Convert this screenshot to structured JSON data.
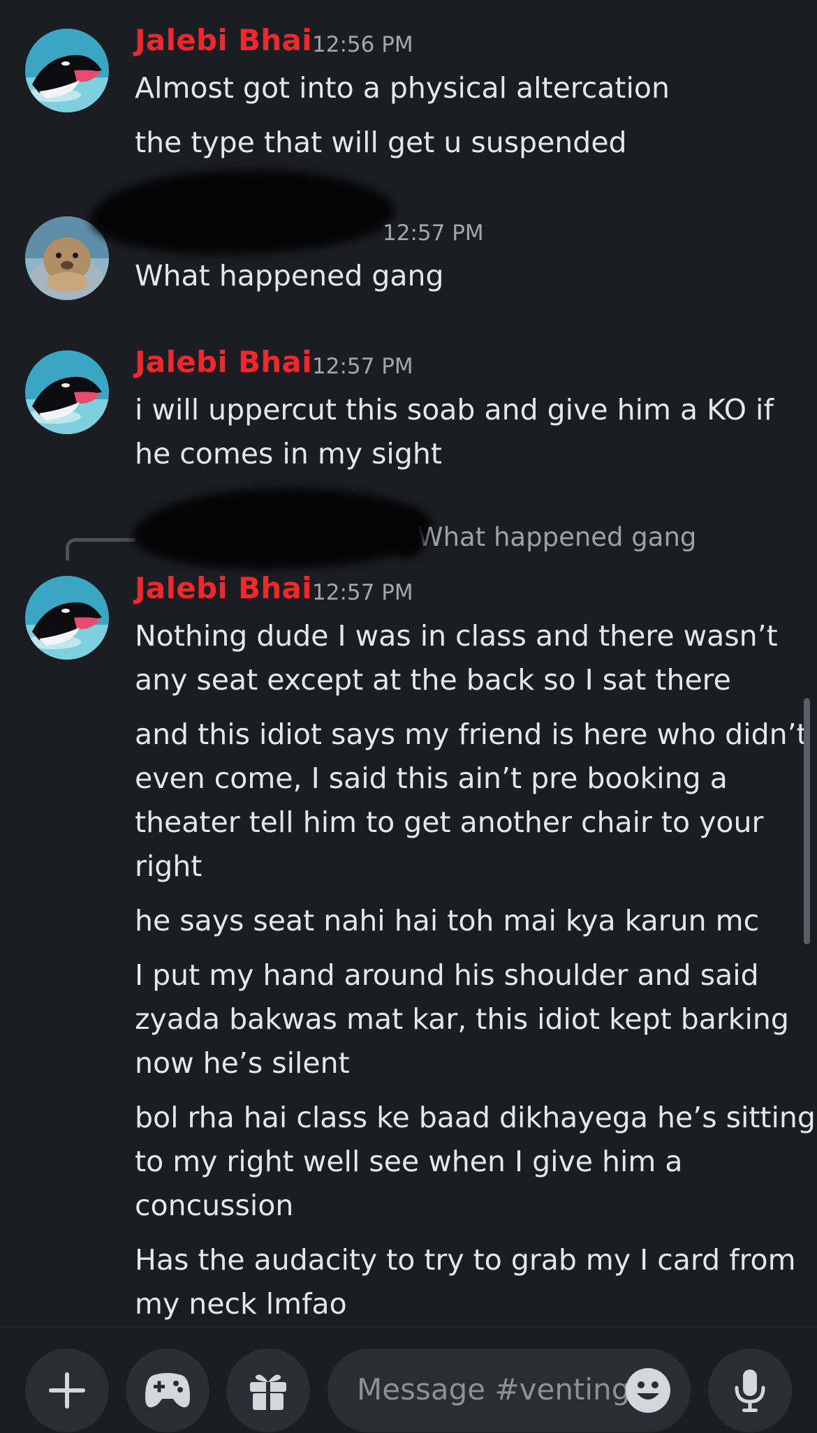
{
  "messages": [
    {
      "author": "Jalebi Bhai",
      "time": "12:56 PM",
      "lines": [
        "Almost got into a physical altercation",
        "the type that will get u suspended"
      ]
    },
    {
      "author": "",
      "time": "12:57 PM",
      "lines": [
        "What happened gang"
      ]
    },
    {
      "author": "Jalebi Bhai",
      "time": "12:57 PM",
      "lines": [
        "i will uppercut this soab and give him a KO if",
        "he comes in my sight"
      ]
    },
    {
      "reply_preview": "What happened gang",
      "author": "Jalebi Bhai",
      "time": "12:57 PM",
      "lines": [
        "Nothing dude I was in class and there wasn’t",
        "any seat except at the back so I sat there",
        "and this idiot says my friend is here who didn’t",
        "even come, I said this ain’t pre booking a",
        "theater tell him to get another chair to your",
        "right",
        "he says seat nahi hai toh mai kya karun mc",
        "I put my hand around his shoulder and said",
        "zyada bakwas mat kar, this idiot kept barking",
        "now he’s silent",
        "bol rha hai class ke baad dikhayega he’s sitting",
        "to my right well see when I give him a",
        "concussion",
        "Has the audacity to try to grab my I card from",
        "my neck lmfao"
      ]
    }
  ],
  "composer": {
    "placeholder": "Message #venting"
  },
  "icons": {
    "add": "plus-icon",
    "activities": "gamepad-icon",
    "gift": "gift-icon",
    "emoji": "emoji-icon",
    "voice": "microphone-icon"
  },
  "colors": {
    "background": "#1c1d22",
    "author_name": "#f0282c",
    "button_bg": "#2b2d34"
  }
}
